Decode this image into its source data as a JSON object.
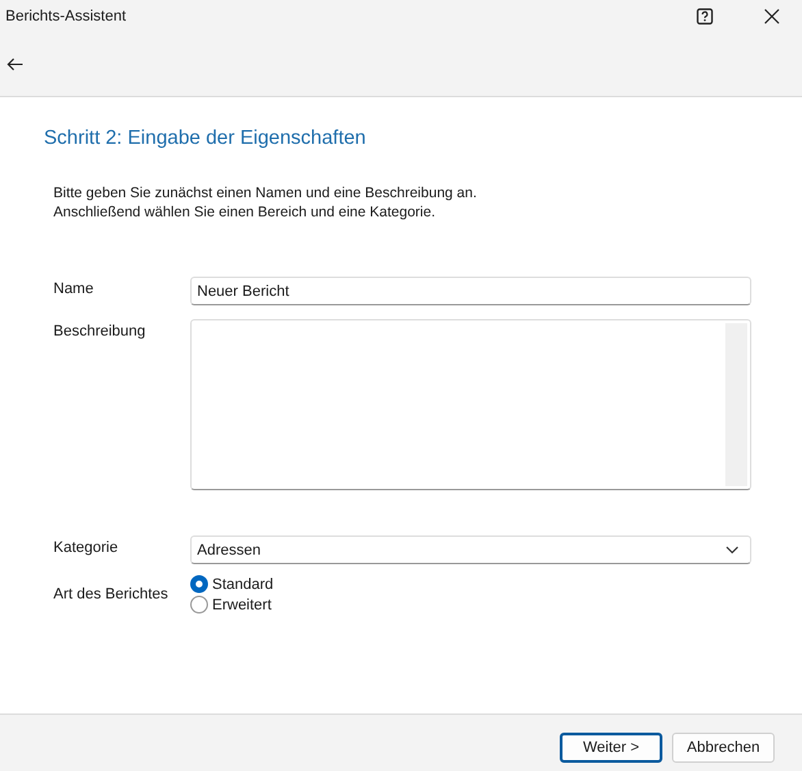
{
  "window": {
    "title": "Berichts-Assistent"
  },
  "heading": "Schritt 2: Eingabe der Eigenschaften",
  "intro": [
    "Bitte geben Sie zunächst einen Namen und eine Beschreibung an.",
    "Anschließend wählen Sie einen Bereich und eine Kategorie."
  ],
  "name": {
    "label": "Name",
    "value": "Neuer Bericht"
  },
  "description": {
    "label": "Beschreibung"
  },
  "category": {
    "label": "Kategorie",
    "value": "Adressen"
  },
  "report_type": {
    "label": "Art des Berichtes",
    "options": [
      {
        "label": "Standard",
        "selected": true
      },
      {
        "label": "Erweitert",
        "selected": false
      }
    ]
  },
  "buttons": [
    {
      "label": "Weiter >",
      "default": true
    },
    {
      "label": "Abbrechen",
      "default": false
    }
  ]
}
